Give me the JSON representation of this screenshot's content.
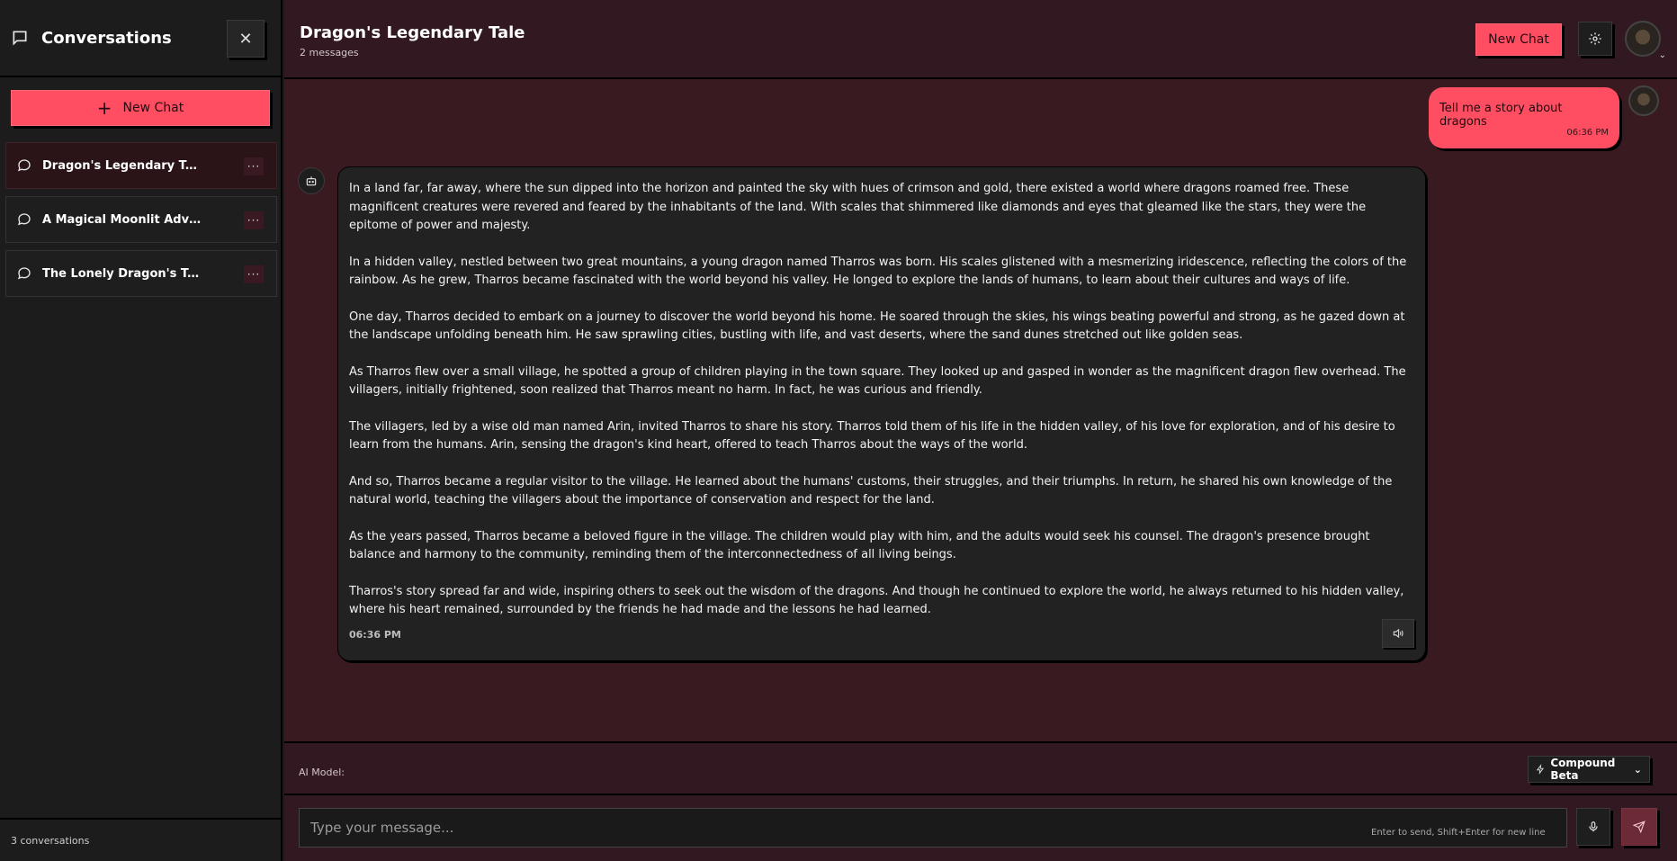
{
  "sidebar": {
    "title": "Conversations",
    "close_label": "✕",
    "new_chat_label": "New Chat",
    "items": [
      {
        "label": "Dragon's Legendary Tal...",
        "more": "···"
      },
      {
        "label": "A Magical Moonlit Adve...",
        "more": "···"
      },
      {
        "label": "The Lonely Dragon's Ta...",
        "more": "···"
      }
    ],
    "footer": "3 conversations"
  },
  "header": {
    "title": "Dragon's Legendary Tale",
    "subtitle": "2 messages",
    "new_chat_label": "New Chat"
  },
  "messages": {
    "user": {
      "text": "Tell me a story about dragons",
      "time": "06:36 PM"
    },
    "bot": {
      "paragraphs": [
        "In a land far, far away, where the sun dipped into the horizon and painted the sky with hues of crimson and gold, there existed a world where dragons roamed free. These magnificent creatures were revered and feared by the inhabitants of the land. With scales that shimmered like diamonds and eyes that gleamed like the stars, they were the epitome of power and majesty.",
        "In a hidden valley, nestled between two great mountains, a young dragon named Tharros was born. His scales glistened with a mesmerizing iridescence, reflecting the colors of the rainbow. As he grew, Tharros became fascinated with the world beyond his valley. He longed to explore the lands of humans, to learn about their cultures and ways of life.",
        "One day, Tharros decided to embark on a journey to discover the world beyond his home. He soared through the skies, his wings beating powerful and strong, as he gazed down at the landscape unfolding beneath him. He saw sprawling cities, bustling with life, and vast deserts, where the sand dunes stretched out like golden seas.",
        "As Tharros flew over a small village, he spotted a group of children playing in the town square. They looked up and gasped in wonder as the magnificent dragon flew overhead. The villagers, initially frightened, soon realized that Tharros meant no harm. In fact, he was curious and friendly.",
        "The villagers, led by a wise old man named Arin, invited Tharros to share his story. Tharros told them of his life in the hidden valley, of his love for exploration, and of his desire to learn from the humans. Arin, sensing the dragon's kind heart, offered to teach Tharros about the ways of the world.",
        "And so, Tharros became a regular visitor to the village. He learned about the humans' customs, their struggles, and their triumphs. In return, he shared his own knowledge of the natural world, teaching the villagers about the importance of conservation and respect for the land.",
        "As the years passed, Tharros became a beloved figure in the village. The children would play with him, and the adults would seek his counsel. The dragon's presence brought balance and harmony to the community, reminding them of the interconnectedness of all living beings.",
        "Tharros's story spread far and wide, inspiring others to seek out the wisdom of the dragons. And though he continued to explore the world, he always returned to his hidden valley, where his heart remained, surrounded by the friends he had made and the lessons he had learned."
      ],
      "time": "06:36 PM"
    }
  },
  "model_bar": {
    "label": "AI Model:",
    "selected": "Compound Beta"
  },
  "composer": {
    "placeholder": "Type your message...",
    "hint": "Enter to send, Shift+Enter for new line"
  },
  "icons": {
    "sidebar_title": "chat-bubble-icon",
    "close": "close-icon",
    "plus": "plus-icon",
    "conversation": "chat-bubble-icon",
    "more": "more-horizontal-icon",
    "settings": "gear-icon",
    "bot": "bot-icon",
    "speaker": "speaker-icon",
    "model": "bolt-icon",
    "mic": "mic-icon",
    "send": "send-icon"
  },
  "colors": {
    "accent": "#ff4d62",
    "main_bg": "#381a20",
    "sidebar_bg": "#1c1c1c",
    "bubble_bg": "#222222"
  }
}
